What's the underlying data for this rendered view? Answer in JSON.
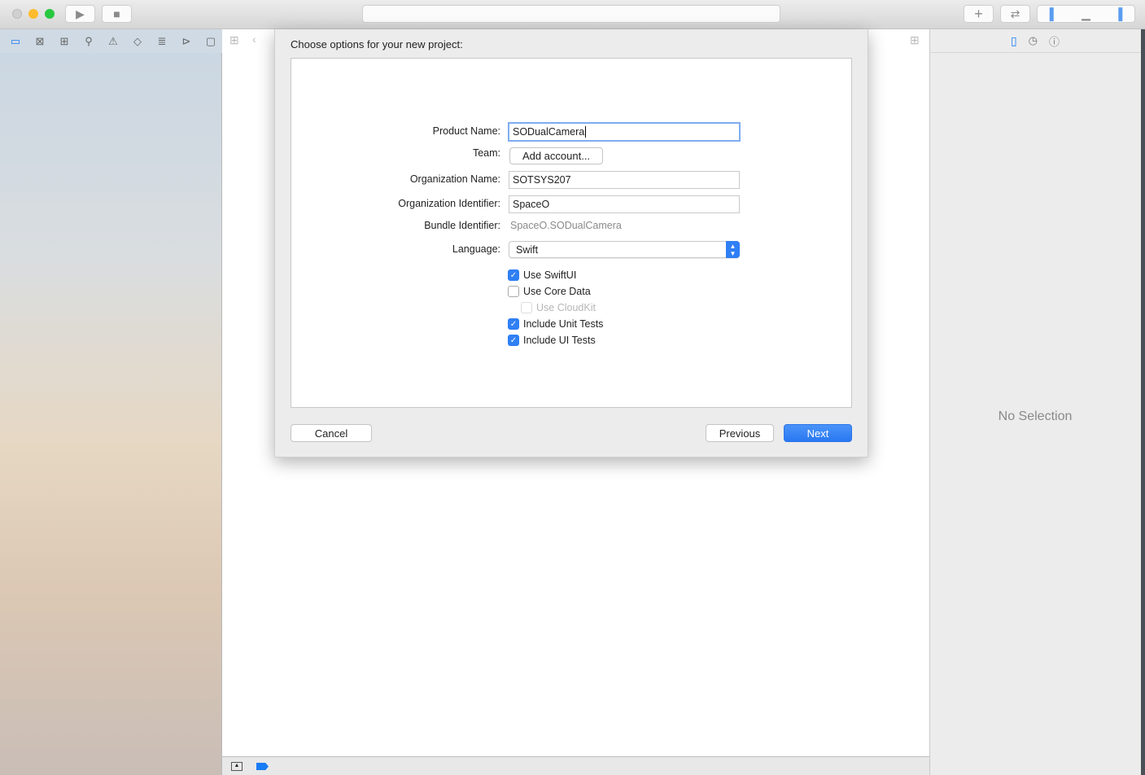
{
  "window": {
    "search_field": ""
  },
  "sheet": {
    "title": "Choose options for your new project:",
    "fields": {
      "product_name_label": "Product Name:",
      "product_name": "SODualCamera",
      "team_label": "Team:",
      "team_button": "Add account...",
      "org_name_label": "Organization Name:",
      "org_name": "SOTSYS207",
      "org_id_label": "Organization Identifier:",
      "org_id": "SpaceO",
      "bundle_label": "Bundle Identifier:",
      "bundle_id": "SpaceO.SODualCamera",
      "language_label": "Language:",
      "language": "Swift"
    },
    "checkboxes": [
      {
        "label": "Use SwiftUI",
        "checked": true
      },
      {
        "label": "Use Core Data",
        "checked": false
      },
      {
        "label": "Use CloudKit",
        "checked": false,
        "disabled": true
      },
      {
        "label": "Include Unit Tests",
        "checked": true
      },
      {
        "label": "Include UI Tests",
        "checked": true
      }
    ],
    "buttons": {
      "cancel": "Cancel",
      "previous": "Previous",
      "next": "Next"
    }
  },
  "inspector": {
    "empty_text": "No Selection"
  },
  "colors": {
    "accent": "#2f7ff5"
  }
}
